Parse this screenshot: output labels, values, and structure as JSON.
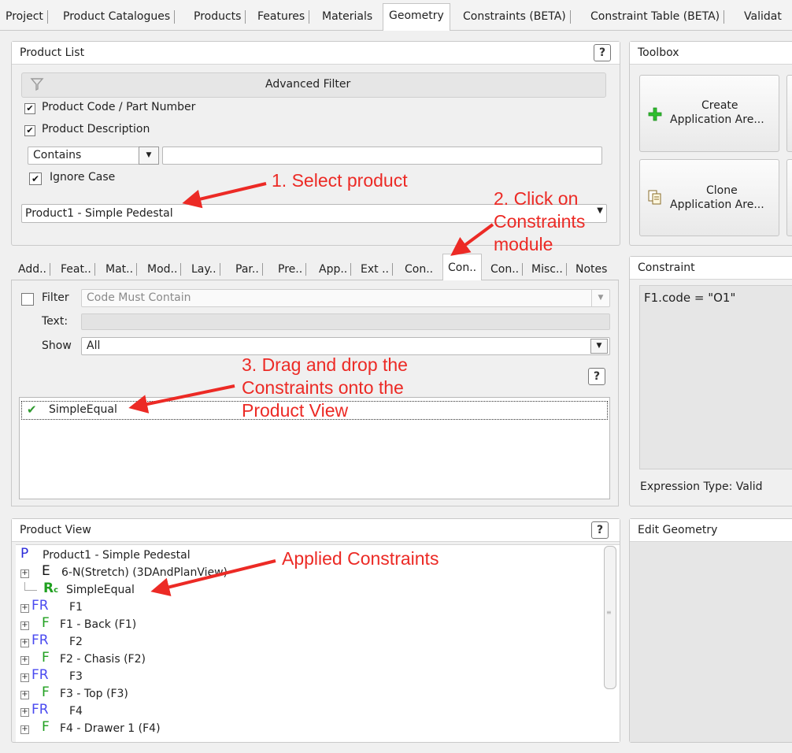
{
  "menu": {
    "tabs": [
      {
        "label": "Project"
      },
      {
        "label": "Product Catalogues"
      },
      {
        "label": "Products"
      },
      {
        "label": "Features"
      },
      {
        "label": "Materials"
      },
      {
        "label": "Geometry"
      },
      {
        "label": "Constraints (BETA)"
      },
      {
        "label": "Constraint Table (BETA)"
      },
      {
        "label": "Validat"
      }
    ],
    "active": "Geometry"
  },
  "product_list": {
    "title": "Product List",
    "help": "?",
    "advanced_filter": "Advanced Filter",
    "opt_code": "Product Code / Part Number",
    "opt_desc": "Product Description",
    "match_mode": "Contains",
    "search_value": "",
    "ignore_case": "Ignore Case",
    "selected_product": "Product1 - Simple Pedestal"
  },
  "toolbox": {
    "title": "Toolbox",
    "create": {
      "line1": "Create",
      "line2": "Application Are..."
    },
    "clone": {
      "line1": "Clone",
      "line2": "Application Are..."
    }
  },
  "module_tabs": [
    "Add..",
    "Feat..",
    "Mat..",
    "Mod..",
    "Lay..",
    "Par..",
    "Pre..",
    "App..",
    "Ext ..",
    "Con..",
    "Con..",
    "Con..",
    "Misc..",
    "Notes"
  ],
  "module_tabs_active_index": 10,
  "constraints_module": {
    "filter_label": "Filter",
    "filter_placeholder": "Code Must Contain",
    "text_label": "Text:",
    "show_label": "Show",
    "show_value": "All",
    "help": "?",
    "items": [
      {
        "label": "SimpleEqual"
      }
    ]
  },
  "constraint": {
    "title": "Constraint",
    "expression": "F1.code = \"O1\"",
    "expression_type": "Expression Type: Valid"
  },
  "product_view": {
    "title": "Product View",
    "help": "?",
    "nodes": [
      {
        "type": "P",
        "label": "Product1 - Simple Pedestal"
      },
      {
        "type": "E",
        "label": "6-N(Stretch) (3DAndPlanView)"
      },
      {
        "type": "Rc",
        "label": "SimpleEqual"
      },
      {
        "type": "FR",
        "label": "F1"
      },
      {
        "type": "F",
        "label": "F1 - Back (F1)"
      },
      {
        "type": "FR",
        "label": "F2"
      },
      {
        "type": "F",
        "label": "F2 - Chasis (F2)"
      },
      {
        "type": "FR",
        "label": "F3"
      },
      {
        "type": "F",
        "label": "F3 - Top (F3)"
      },
      {
        "type": "FR",
        "label": "F4"
      },
      {
        "type": "F",
        "label": "F4 - Drawer 1 (F4)"
      }
    ]
  },
  "edit_geometry": {
    "title": "Edit Geometry"
  },
  "annotations": {
    "step1": "1. Select product",
    "step2_l1": "2. Click on",
    "step2_l2": "Constraints",
    "step2_l3": "module",
    "step3_l1": "3. Drag and drop the",
    "step3_l2": "Constraints onto the",
    "step3_l3": "Product View",
    "applied": "Applied Constraints"
  },
  "colors": {
    "annotation_red": "#ec2a25",
    "type_P": "#2b2bd9",
    "type_FR": "#4a4af0",
    "type_F": "#20a020",
    "type_Rc": "#20a020",
    "check_green": "#2f9a2f"
  }
}
